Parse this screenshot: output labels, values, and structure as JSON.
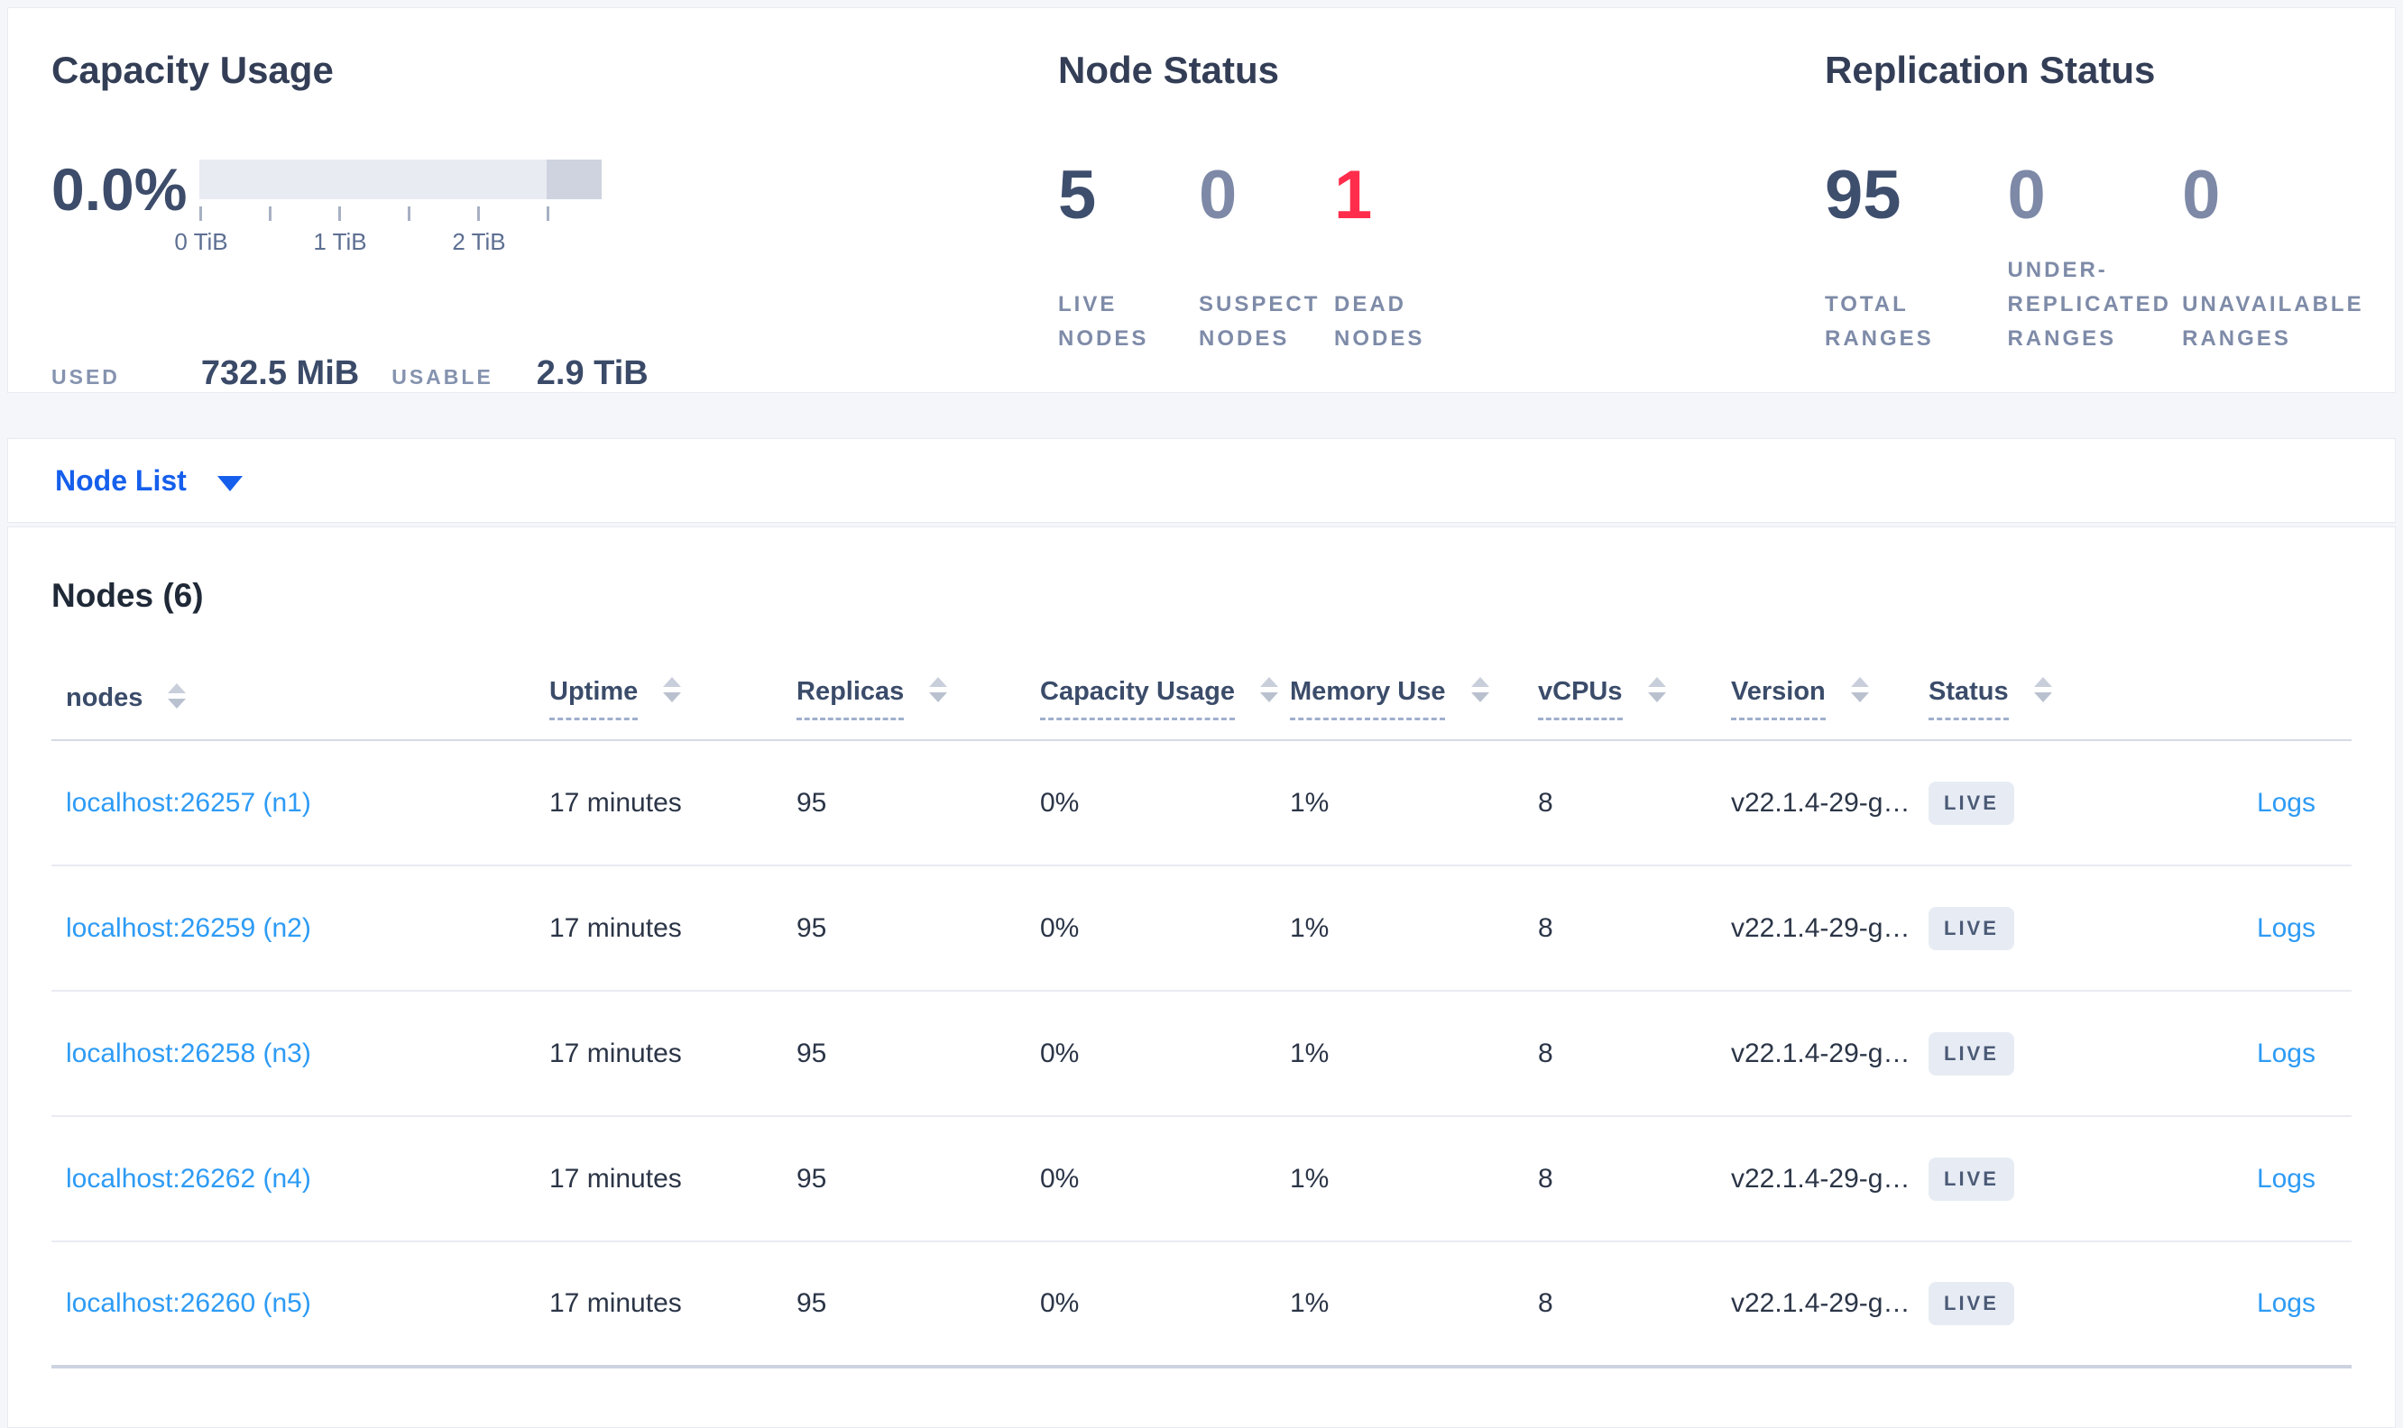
{
  "summary": {
    "capacity": {
      "title": "Capacity Usage",
      "percent": "0.0%",
      "ticks": [
        "0 TiB",
        "1 TiB",
        "2 TiB"
      ],
      "used_label": "USED",
      "used_value": "732.5 MiB",
      "usable_label": "USABLE",
      "usable_value": "2.9 TiB"
    },
    "node_status": {
      "title": "Node Status",
      "live": {
        "value": "5",
        "label": "LIVE NODES"
      },
      "suspect": {
        "value": "0",
        "label": "SUSPECT NODES"
      },
      "dead": {
        "value": "1",
        "label": "DEAD NODES"
      }
    },
    "replication": {
      "title": "Replication Status",
      "total": {
        "value": "95",
        "label": "TOTAL RANGES"
      },
      "under": {
        "value": "0",
        "label": "UNDER-REPLICATED RANGES"
      },
      "unavailable": {
        "value": "0",
        "label": "UNAVAILABLE RANGES"
      }
    }
  },
  "toolbar": {
    "view_label": "Node List"
  },
  "nodes_section": {
    "title": "Nodes (6)",
    "columns": [
      "nodes",
      "Uptime",
      "Replicas",
      "Capacity Usage",
      "Memory Use",
      "vCPUs",
      "Version",
      "Status"
    ],
    "logs_label": "Logs",
    "rows": [
      {
        "node": "localhost:26257 (n1)",
        "uptime": "17 minutes",
        "replicas": "95",
        "capacity": "0%",
        "memory": "1%",
        "vcpus": "8",
        "version": "v22.1.4-29-g…",
        "status": "LIVE"
      },
      {
        "node": "localhost:26259 (n2)",
        "uptime": "17 minutes",
        "replicas": "95",
        "capacity": "0%",
        "memory": "1%",
        "vcpus": "8",
        "version": "v22.1.4-29-g…",
        "status": "LIVE"
      },
      {
        "node": "localhost:26258 (n3)",
        "uptime": "17 minutes",
        "replicas": "95",
        "capacity": "0%",
        "memory": "1%",
        "vcpus": "8",
        "version": "v22.1.4-29-g…",
        "status": "LIVE"
      },
      {
        "node": "localhost:26262 (n4)",
        "uptime": "17 minutes",
        "replicas": "95",
        "capacity": "0%",
        "memory": "1%",
        "vcpus": "8",
        "version": "v22.1.4-29-g…",
        "status": "LIVE"
      },
      {
        "node": "localhost:26260 (n5)",
        "uptime": "17 minutes",
        "replicas": "95",
        "capacity": "0%",
        "memory": "1%",
        "vcpus": "8",
        "version": "v22.1.4-29-g…",
        "status": "LIVE"
      }
    ]
  },
  "colors": {
    "accent_blue": "#155fec",
    "link_blue": "#2d9bf5",
    "danger_red": "#ff2d4b",
    "stat_dark": "#3e4e6d",
    "stat_muted": "#7d89a6",
    "badge_bg": "#e7ecf4",
    "bar_bg": "#e9ebf2",
    "bar_reserved": "#ced3df"
  }
}
